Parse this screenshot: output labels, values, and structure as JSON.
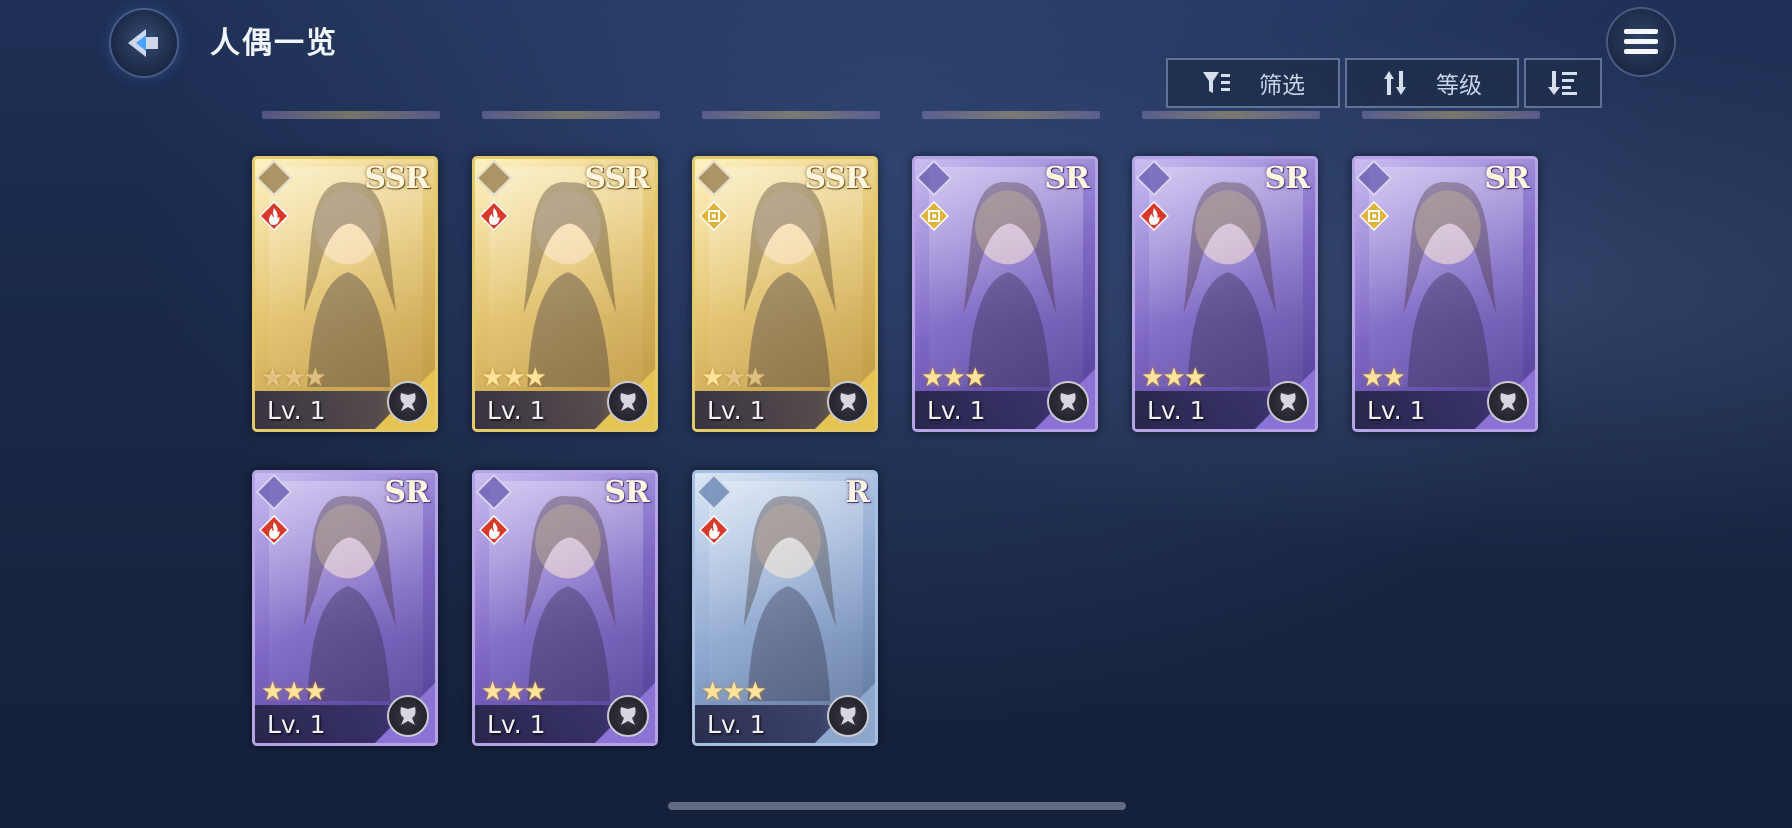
{
  "header": {
    "title": "人偶一览",
    "back_icon": "back-arrow-icon",
    "menu_icon": "hamburger-menu-icon"
  },
  "toolbar": {
    "filter_label": "筛选",
    "sort_label": "等级",
    "filter_icon": "filter-icon",
    "sort_icon": "sort-arrows-icon",
    "order_icon": "sort-descending-icon"
  },
  "colors": {
    "ssr_frame": "#e2c96a",
    "sr_frame": "#b6a3e6",
    "r_frame": "#a7bfe3",
    "fire_element": "#d73a2a",
    "support_element": "#e0b43a"
  },
  "cards": [
    {
      "rarity": "SSR",
      "level": "Lv. 1",
      "stars": 3,
      "stars_filled": 0,
      "element": "fire"
    },
    {
      "rarity": "SSR",
      "level": "Lv. 1",
      "stars": 3,
      "stars_filled": 3,
      "element": "fire"
    },
    {
      "rarity": "SSR",
      "level": "Lv. 1",
      "stars": 3,
      "stars_filled": 1,
      "element": "light"
    },
    {
      "rarity": "SR",
      "level": "Lv. 1",
      "stars": 3,
      "stars_filled": 3,
      "element": "light"
    },
    {
      "rarity": "SR",
      "level": "Lv. 1",
      "stars": 3,
      "stars_filled": 3,
      "element": "fire"
    },
    {
      "rarity": "SR",
      "level": "Lv. 1",
      "stars": 2,
      "stars_filled": 2,
      "element": "light"
    },
    {
      "rarity": "SR",
      "level": "Lv. 1",
      "stars": 3,
      "stars_filled": 3,
      "element": "fire"
    },
    {
      "rarity": "SR",
      "level": "Lv. 1",
      "stars": 3,
      "stars_filled": 3,
      "element": "fire"
    },
    {
      "rarity": "R",
      "level": "Lv. 1",
      "stars": 3,
      "stars_filled": 3,
      "element": "fire"
    }
  ]
}
